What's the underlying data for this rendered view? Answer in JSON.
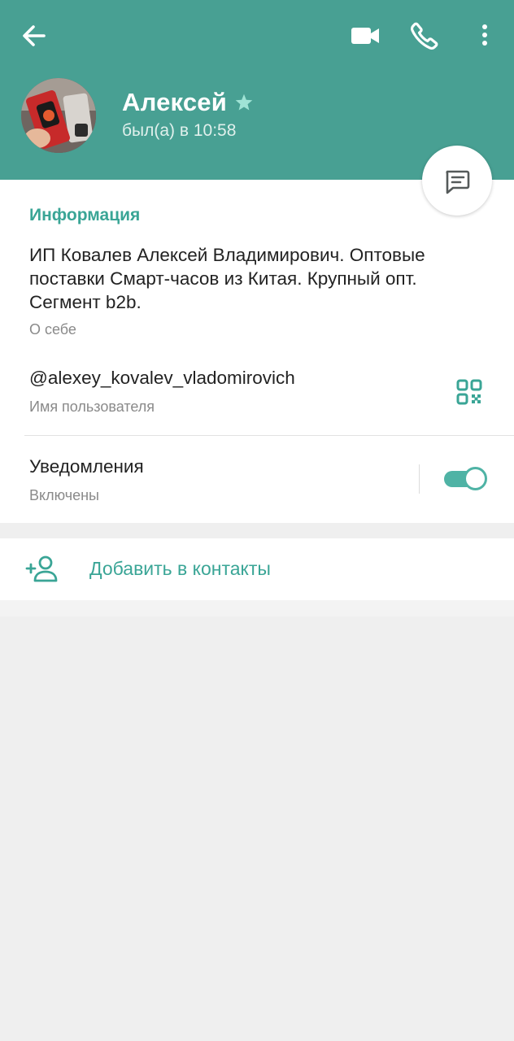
{
  "header": {
    "name": "Алексей",
    "last_seen": "был(а) в 10:58"
  },
  "icons": {
    "back": "arrow-left-icon",
    "video": "video-camera-icon",
    "call": "phone-icon",
    "more": "more-vertical-icon",
    "star": "star-icon",
    "message": "message-icon",
    "qr": "qr-code-icon",
    "add_contact": "add-user-icon"
  },
  "info": {
    "section_title": "Информация",
    "about": "ИП Ковалев Алексей Владимирович. Оптовые поставки Смарт-часов из Китая. Крупный опт. Сегмент b2b.",
    "about_label": "О себе",
    "username": "@alexey_kovalev_vladomirovich",
    "username_label": "Имя пользователя",
    "notifications_title": "Уведомления",
    "notifications_status": "Включены",
    "notifications_enabled": true
  },
  "actions": {
    "add_to_contacts": "Добавить в контакты"
  },
  "colors": {
    "header_bg": "#48a093",
    "accent": "#3aa596",
    "page_bg": "#efefef"
  }
}
